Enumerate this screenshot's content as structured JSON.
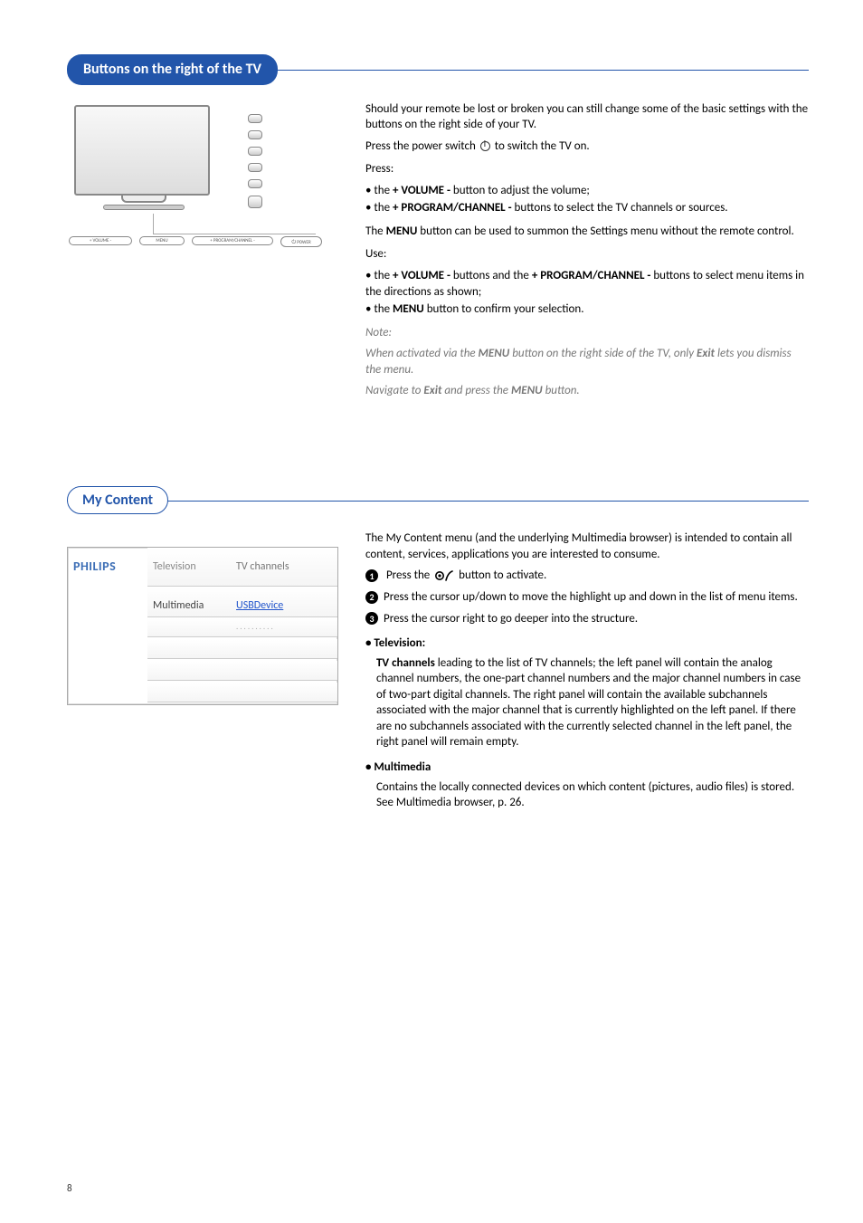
{
  "section1": {
    "title": "Buttons on the right of the TV",
    "intro1": "Should your remote be lost or broken you can still change some of the basic settings with the buttons on the right side of your TV.",
    "intro2a": "Press the power switch ",
    "intro2b": " to switch the TV on.",
    "press_hdr": "Press:",
    "press_b1a": "the ",
    "press_b1b": "+ VOLUME -",
    "press_b1c": " button to adjust the volume;",
    "press_b2a": "the ",
    "press_b2b": "+ PROGRAM/CHANNEL -",
    "press_b2c": " buttons to select the TV channels or sources.",
    "menu1a": "The ",
    "menu1b": "MENU",
    "menu1c": " button can be used to summon the Settings menu without the remote control.",
    "use_hdr": "Use:",
    "use_b1a": "the ",
    "use_b1b": "+ VOLUME -",
    "use_b1c": "  buttons and the ",
    "use_b1d": "+ PROGRAM/CHANNEL -",
    "use_b1e": "  buttons to select menu items in the directions as shown;",
    "use_b2a": "the ",
    "use_b2b": "MENU",
    "use_b2c": " button to confirm your selection.",
    "note_hdr": "Note:",
    "note_body1a": "When activated via the ",
    "note_body1b": "MENU",
    "note_body1c": " button on the right side of the TV, only ",
    "note_body1d": "Exit",
    "note_body1e": " lets you dismiss the menu.",
    "note_body2a": "Navigate to ",
    "note_body2b": "Exit",
    "note_body2c": " and press the ",
    "note_body2d": "MENU",
    "note_body2e": " button.",
    "labels": {
      "volume": "+      VOLUME       -",
      "menu": "MENU",
      "program": "+    PROGRAM/CHANNEL    -",
      "power": "POWER"
    }
  },
  "section2": {
    "title": "My Content",
    "intro": "The My Content menu (and the underlying Multimedia browser) is intended to contain all content, services, applications you are interested to consume.",
    "step1a": "Press the ",
    "step1b": " button to activate.",
    "step2": "Press the cursor up/down to move the highlight up and down in the list of menu items.",
    "step3": "Press the cursor right to go deeper into the structure.",
    "tv_hdr": "Television:",
    "tv_body_lead": "TV channels",
    "tv_body_rest": " leading to the list of TV channels; the left panel will contain the analog channel numbers, the one-part channel numbers and the major channel numbers in case of two-part digital channels. The right panel will contain the available subchannels associated with the major channel that is currently highlighted on the left panel. If there are no subchannels associated with the currently selected channel in the left panel, the right panel will remain empty.",
    "mm_hdr": "Multimedia",
    "mm_body": "Contains the locally connected devices on which content (pictures, audio files) is stored. See Multimedia browser, p. 26.",
    "shot": {
      "logo": "PHILIPS",
      "col1_r1": "Television",
      "col1_r2": "Multimedia",
      "col2_r1": "TV channels",
      "col2_r2": "USBDevice",
      "col2_r3": ".........."
    }
  },
  "page_number": "8"
}
